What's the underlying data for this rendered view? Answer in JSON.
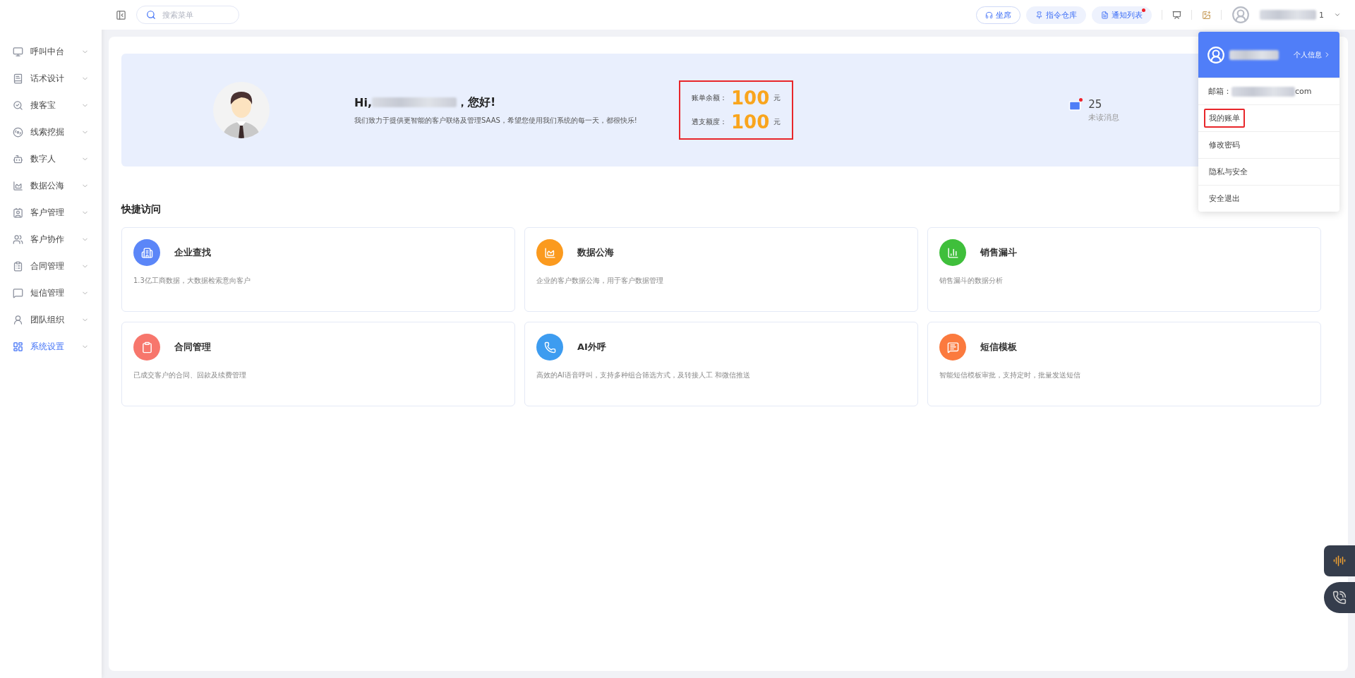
{
  "topbar": {
    "search": {
      "placeholder": "搜索菜单"
    },
    "buttons": [
      {
        "label": "坐席",
        "kind": "outline",
        "badge_dot": false
      },
      {
        "label": "指令仓库",
        "kind": "soft",
        "badge_dot": false
      },
      {
        "label": "通知列表",
        "kind": "soft",
        "badge_dot": true
      }
    ],
    "user_name_tail": "1"
  },
  "sidebar": {
    "items": [
      {
        "label": "呼叫中台",
        "selected": false
      },
      {
        "label": "话术设计",
        "selected": false
      },
      {
        "label": "搜客宝",
        "selected": false
      },
      {
        "label": "线索挖掘",
        "selected": false
      },
      {
        "label": "数字人",
        "selected": false
      },
      {
        "label": "数据公海",
        "selected": false
      },
      {
        "label": "客户管理",
        "selected": false
      },
      {
        "label": "客户协作",
        "selected": false
      },
      {
        "label": "合同管理",
        "selected": false
      },
      {
        "label": "短信管理",
        "selected": false
      },
      {
        "label": "团队组织",
        "selected": false
      },
      {
        "label": "系统设置",
        "selected": true
      }
    ]
  },
  "banner": {
    "greeting_prefix": "Hi,",
    "greeting_suffix": "，您好!",
    "subtitle": "我们致力于提供更智能的客户联络及管理SAAS，希望您使用我们系统的每一天，都很快乐!",
    "highlighted": true,
    "balances": [
      {
        "label": "账单余额：",
        "value": "100",
        "unit": "元"
      },
      {
        "label": "透支额度：",
        "value": "100",
        "unit": "元"
      }
    ],
    "messages": {
      "count": "25",
      "label": "未读消息",
      "unread_dot": true
    }
  },
  "quick_access": {
    "title": "快捷访问",
    "cards": [
      {
        "title": "企业查找",
        "desc": "1.3亿工商数据，大数据检索意向客户",
        "color": "#5b86f8"
      },
      {
        "title": "数据公海",
        "desc": "企业的客户数据公海，用于客户数据管理",
        "color": "#fb9a1e"
      },
      {
        "title": "销售漏斗",
        "desc": "销售漏斗的数据分析",
        "color": "#3fbf3b"
      },
      {
        "title": "合同管理",
        "desc": "已成交客户的合同、回款及续费管理",
        "color": "#f7766c"
      },
      {
        "title": "AI外呼",
        "desc": "高效的AI语音呼叫，支持多种组合筛选方式，及转接人工 和微信推送",
        "color": "#3d9cf0"
      },
      {
        "title": "短信模板",
        "desc": "智能短信模板审批，支持定时，批量发送短信",
        "color": "#fb7a3e"
      }
    ]
  },
  "user_menu": {
    "header_link": "个人信息",
    "email_label": "邮箱：",
    "email_tail": "com",
    "items": [
      {
        "label": "我的账单",
        "highlighted": true
      },
      {
        "label": "修改密码",
        "highlighted": false
      },
      {
        "label": "隐私与安全",
        "highlighted": false
      },
      {
        "label": "安全退出",
        "highlighted": false
      }
    ]
  }
}
